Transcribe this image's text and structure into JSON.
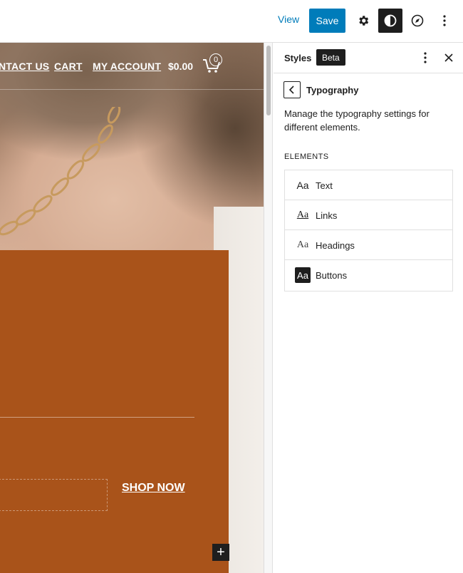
{
  "toolbar": {
    "view_label": "View",
    "save_label": "Save",
    "icons": [
      "gear-icon",
      "half-circle-contrast-icon",
      "compass-icon",
      "vertical-ellipsis-icon"
    ]
  },
  "canvas": {
    "nav": {
      "contact_label": "NTACT US",
      "cart_label": "CART",
      "account_label": "MY ACCOUNT",
      "price": "$0.00",
      "cart_count": "0"
    },
    "promo": {
      "cta_label": "SHOP NOW",
      "color": "#a9531a"
    },
    "add_block_symbol": "+"
  },
  "sidebar": {
    "title": "Styles",
    "badge": "Beta",
    "section_title": "Typography",
    "description": "Manage the typography settings for different elements.",
    "elements_heading": "ELEMENTS",
    "elements": [
      {
        "preview": "Aa",
        "label": "Text"
      },
      {
        "preview": "Aa",
        "label": "Links"
      },
      {
        "preview": "Aa",
        "label": "Headings"
      },
      {
        "preview": "Aa",
        "label": "Buttons"
      }
    ]
  },
  "colors": {
    "accent": "#007cba",
    "dark": "#1e1e1e"
  }
}
